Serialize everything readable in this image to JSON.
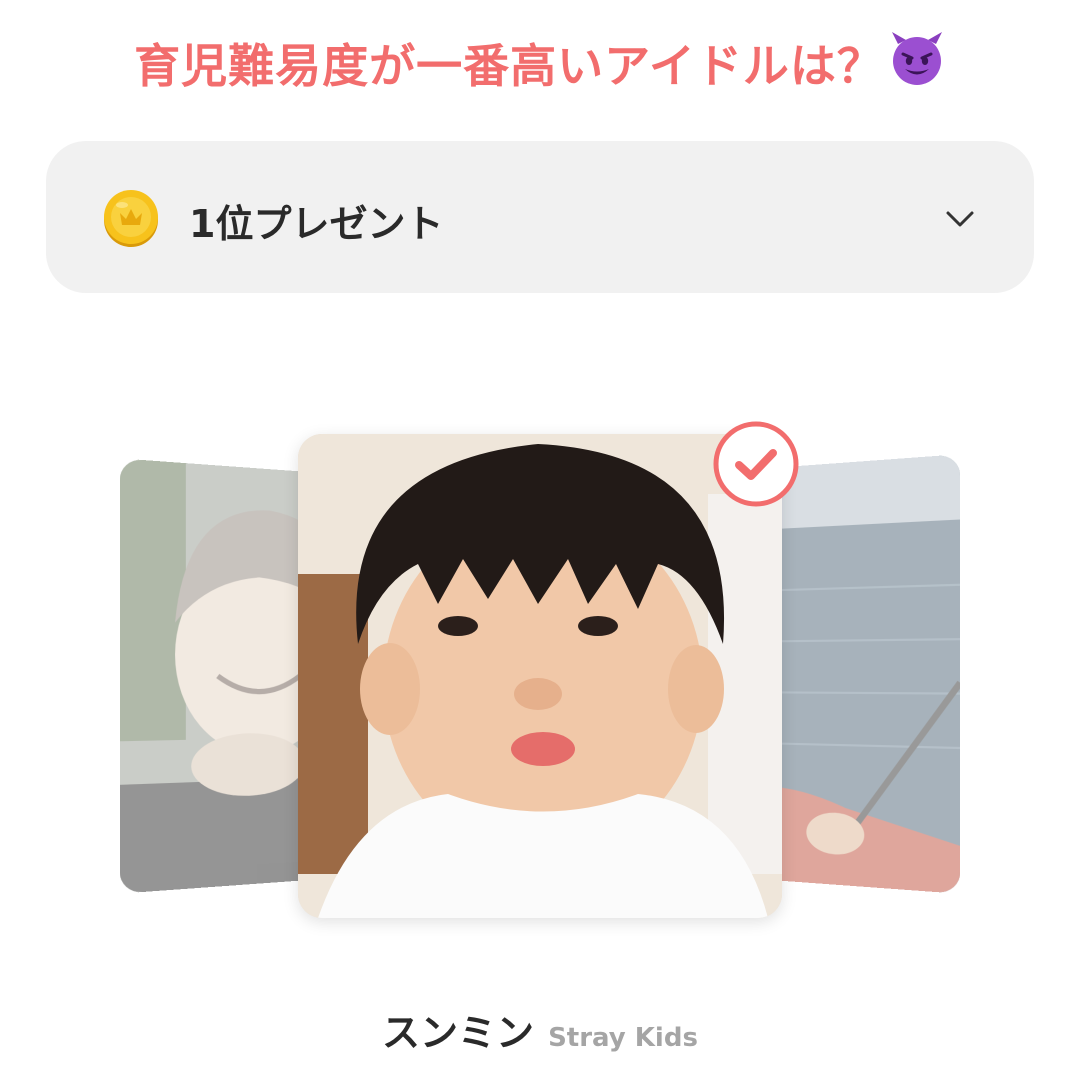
{
  "header": {
    "question": "育児難易度が一番高いアイドルは？",
    "emoji_icon": "smiling-devil-emoji-icon"
  },
  "prize": {
    "label": "1位プレゼント",
    "coin_icon": "gold-coin-icon",
    "toggle_icon": "chevron-down-icon"
  },
  "carousel": {
    "cards": [
      {
        "position": "left",
        "selected": false
      },
      {
        "position": "center",
        "selected": true
      },
      {
        "position": "right",
        "selected": false
      }
    ],
    "selected_icon": "check-circle-icon"
  },
  "selection": {
    "name": "スンミン",
    "group": "Stray Kids"
  },
  "colors": {
    "accent": "#f26d6d",
    "panel": "#f1f1f1",
    "text_dark": "#2a2a2a",
    "text_muted": "#a5a5a5"
  }
}
